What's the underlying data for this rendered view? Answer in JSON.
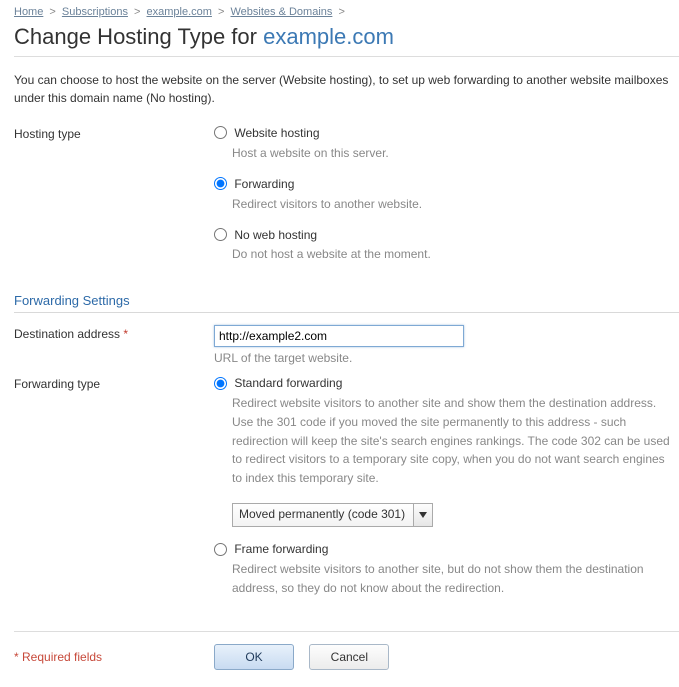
{
  "breadcrumb": {
    "items": [
      "Home",
      "Subscriptions",
      "example.com",
      "Websites & Domains"
    ],
    "sep": ">"
  },
  "title": {
    "prefix": "Change Hosting Type for ",
    "domain": "example.com"
  },
  "intro": "You can choose to host the website on the server (Website hosting), to set up web forwarding to another website mailboxes under this domain name (No hosting).",
  "hosting_type": {
    "label": "Hosting type",
    "options": {
      "website": {
        "label": "Website hosting",
        "hint": "Host a website on this server."
      },
      "forward": {
        "label": "Forwarding",
        "hint": "Redirect visitors to another website."
      },
      "none": {
        "label": "No web hosting",
        "hint": "Do not host a website at the moment."
      }
    }
  },
  "forwarding_section": "Forwarding Settings",
  "dest": {
    "label": "Destination address",
    "req": "*",
    "value": "http://example2.com",
    "hint": "URL of the target website."
  },
  "fwd_type": {
    "label": "Forwarding type",
    "standard": {
      "label": "Standard forwarding",
      "desc": "Redirect website visitors to another site and show them the destination address. Use the 301 code if you moved the site permanently to this address - such redirection will keep the site's search engines rankings. The code 302 can be used to redirect visitors to a temporary site copy, when you do not want search engines to index this temporary site.",
      "select": "Moved permanently (code 301)"
    },
    "frame": {
      "label": "Frame forwarding",
      "desc": "Redirect website visitors to another site, but do not show them the destination address, so they do not know about the redirection."
    }
  },
  "footer": {
    "req_note": "* Required fields",
    "ok": "OK",
    "cancel": "Cancel"
  }
}
